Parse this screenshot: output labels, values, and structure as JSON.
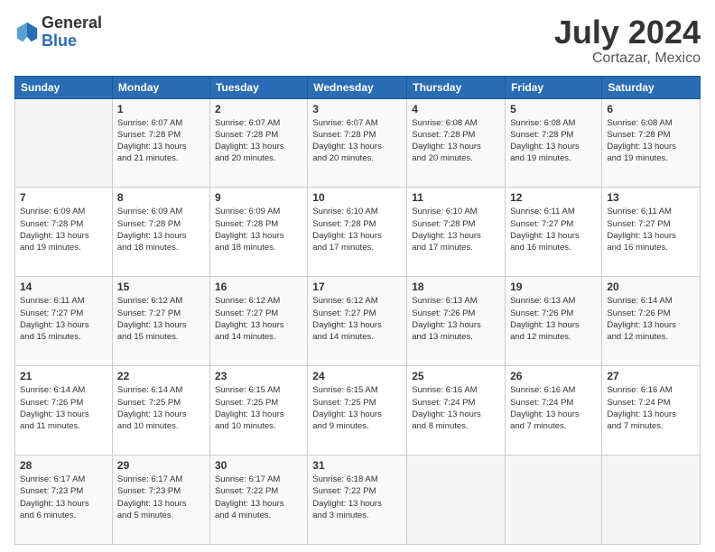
{
  "logo": {
    "general": "General",
    "blue": "Blue"
  },
  "title": {
    "month_year": "July 2024",
    "location": "Cortazar, Mexico"
  },
  "days_of_week": [
    "Sunday",
    "Monday",
    "Tuesday",
    "Wednesday",
    "Thursday",
    "Friday",
    "Saturday"
  ],
  "weeks": [
    [
      {
        "day": "",
        "info": ""
      },
      {
        "day": "1",
        "info": "Sunrise: 6:07 AM\nSunset: 7:28 PM\nDaylight: 13 hours\nand 21 minutes."
      },
      {
        "day": "2",
        "info": "Sunrise: 6:07 AM\nSunset: 7:28 PM\nDaylight: 13 hours\nand 20 minutes."
      },
      {
        "day": "3",
        "info": "Sunrise: 6:07 AM\nSunset: 7:28 PM\nDaylight: 13 hours\nand 20 minutes."
      },
      {
        "day": "4",
        "info": "Sunrise: 6:08 AM\nSunset: 7:28 PM\nDaylight: 13 hours\nand 20 minutes."
      },
      {
        "day": "5",
        "info": "Sunrise: 6:08 AM\nSunset: 7:28 PM\nDaylight: 13 hours\nand 19 minutes."
      },
      {
        "day": "6",
        "info": "Sunrise: 6:08 AM\nSunset: 7:28 PM\nDaylight: 13 hours\nand 19 minutes."
      }
    ],
    [
      {
        "day": "7",
        "info": "Sunrise: 6:09 AM\nSunset: 7:28 PM\nDaylight: 13 hours\nand 19 minutes."
      },
      {
        "day": "8",
        "info": "Sunrise: 6:09 AM\nSunset: 7:28 PM\nDaylight: 13 hours\nand 18 minutes."
      },
      {
        "day": "9",
        "info": "Sunrise: 6:09 AM\nSunset: 7:28 PM\nDaylight: 13 hours\nand 18 minutes."
      },
      {
        "day": "10",
        "info": "Sunrise: 6:10 AM\nSunset: 7:28 PM\nDaylight: 13 hours\nand 17 minutes."
      },
      {
        "day": "11",
        "info": "Sunrise: 6:10 AM\nSunset: 7:28 PM\nDaylight: 13 hours\nand 17 minutes."
      },
      {
        "day": "12",
        "info": "Sunrise: 6:11 AM\nSunset: 7:27 PM\nDaylight: 13 hours\nand 16 minutes."
      },
      {
        "day": "13",
        "info": "Sunrise: 6:11 AM\nSunset: 7:27 PM\nDaylight: 13 hours\nand 16 minutes."
      }
    ],
    [
      {
        "day": "14",
        "info": "Sunrise: 6:11 AM\nSunset: 7:27 PM\nDaylight: 13 hours\nand 15 minutes."
      },
      {
        "day": "15",
        "info": "Sunrise: 6:12 AM\nSunset: 7:27 PM\nDaylight: 13 hours\nand 15 minutes."
      },
      {
        "day": "16",
        "info": "Sunrise: 6:12 AM\nSunset: 7:27 PM\nDaylight: 13 hours\nand 14 minutes."
      },
      {
        "day": "17",
        "info": "Sunrise: 6:12 AM\nSunset: 7:27 PM\nDaylight: 13 hours\nand 14 minutes."
      },
      {
        "day": "18",
        "info": "Sunrise: 6:13 AM\nSunset: 7:26 PM\nDaylight: 13 hours\nand 13 minutes."
      },
      {
        "day": "19",
        "info": "Sunrise: 6:13 AM\nSunset: 7:26 PM\nDaylight: 13 hours\nand 12 minutes."
      },
      {
        "day": "20",
        "info": "Sunrise: 6:14 AM\nSunset: 7:26 PM\nDaylight: 13 hours\nand 12 minutes."
      }
    ],
    [
      {
        "day": "21",
        "info": "Sunrise: 6:14 AM\nSunset: 7:26 PM\nDaylight: 13 hours\nand 11 minutes."
      },
      {
        "day": "22",
        "info": "Sunrise: 6:14 AM\nSunset: 7:25 PM\nDaylight: 13 hours\nand 10 minutes."
      },
      {
        "day": "23",
        "info": "Sunrise: 6:15 AM\nSunset: 7:25 PM\nDaylight: 13 hours\nand 10 minutes."
      },
      {
        "day": "24",
        "info": "Sunrise: 6:15 AM\nSunset: 7:25 PM\nDaylight: 13 hours\nand 9 minutes."
      },
      {
        "day": "25",
        "info": "Sunrise: 6:16 AM\nSunset: 7:24 PM\nDaylight: 13 hours\nand 8 minutes."
      },
      {
        "day": "26",
        "info": "Sunrise: 6:16 AM\nSunset: 7:24 PM\nDaylight: 13 hours\nand 7 minutes."
      },
      {
        "day": "27",
        "info": "Sunrise: 6:16 AM\nSunset: 7:24 PM\nDaylight: 13 hours\nand 7 minutes."
      }
    ],
    [
      {
        "day": "28",
        "info": "Sunrise: 6:17 AM\nSunset: 7:23 PM\nDaylight: 13 hours\nand 6 minutes."
      },
      {
        "day": "29",
        "info": "Sunrise: 6:17 AM\nSunset: 7:23 PM\nDaylight: 13 hours\nand 5 minutes."
      },
      {
        "day": "30",
        "info": "Sunrise: 6:17 AM\nSunset: 7:22 PM\nDaylight: 13 hours\nand 4 minutes."
      },
      {
        "day": "31",
        "info": "Sunrise: 6:18 AM\nSunset: 7:22 PM\nDaylight: 13 hours\nand 3 minutes."
      },
      {
        "day": "",
        "info": ""
      },
      {
        "day": "",
        "info": ""
      },
      {
        "day": "",
        "info": ""
      }
    ]
  ]
}
